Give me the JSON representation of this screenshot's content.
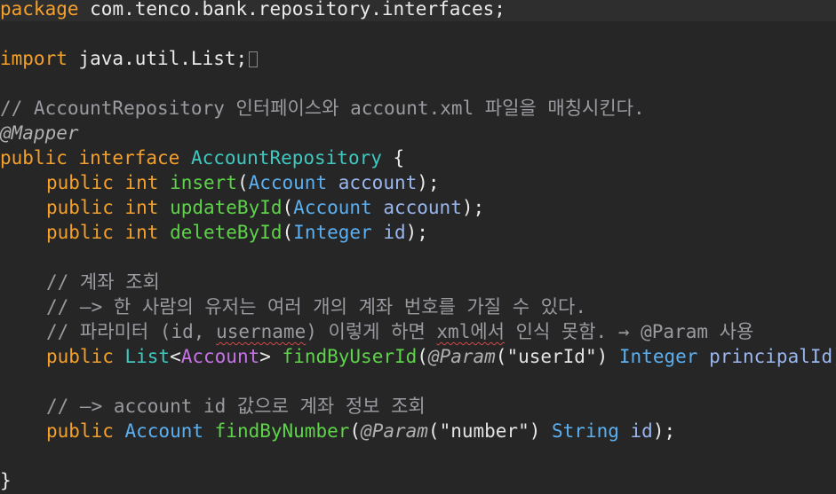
{
  "editor": {
    "lines": {
      "package_kw": "package",
      "package_name": " com.tenco.bank.repository.interfaces;",
      "import_kw": "import",
      "import_name": " java.util.List;",
      "comment_top": "// AccountRepository 인터페이스와 account.xml 파일을 매칭시킨다.",
      "annotation_mapper": "@Mapper",
      "iface_public": "public",
      "iface_interface": " interface ",
      "iface_name": "AccountRepository",
      "iface_brace": " {",
      "insert": {
        "mod": "public",
        "ret": " int ",
        "name": "insert",
        "open": "(",
        "ptype": "Account",
        "pname": " account",
        "close": ");"
      },
      "update": {
        "mod": "public",
        "ret": " int ",
        "name": "updateById",
        "open": "(",
        "ptype": "Account",
        "pname": " account",
        "close": ");"
      },
      "delete": {
        "mod": "public",
        "ret": " int ",
        "name": "deleteById",
        "open": "(",
        "ptype": "Integer",
        "pname": " id",
        "close": ");"
      },
      "comment_lookup": "// 계좌 조회",
      "comment_multi": "// —> 한 사람의 유저는 여러 개의 계좌 번호를 가질 수 있다.",
      "comment_param_a": "// 파라미터 (id, ",
      "comment_param_username": "username",
      "comment_param_b": ") 이렇게 하면 ",
      "comment_param_xml": "xml에서",
      "comment_param_c": " 인식 못함. → @Param 사용",
      "find_user": {
        "mod": "public",
        "list": " List",
        "lt": "<",
        "generic": "Account",
        "gt": ">",
        "name": " findByUserId",
        "open": "(",
        "anno": "@Param",
        "aopen": "(",
        "str": "\"userId\"",
        "aclose": ")",
        "ptype": " Integer",
        "pname": " principalId",
        "close": ");"
      },
      "comment_account_id": "// —> account id 값으로 계좌 정보 조회",
      "find_number": {
        "mod": "public",
        "ret": " Account",
        "name": " findByNumber",
        "open": "(",
        "anno": "@Param",
        "aopen": "(",
        "str": "\"number\"",
        "aclose": ")",
        "ptype": " String",
        "pname": " id",
        "close": ");"
      },
      "closing_brace": "}"
    }
  }
}
